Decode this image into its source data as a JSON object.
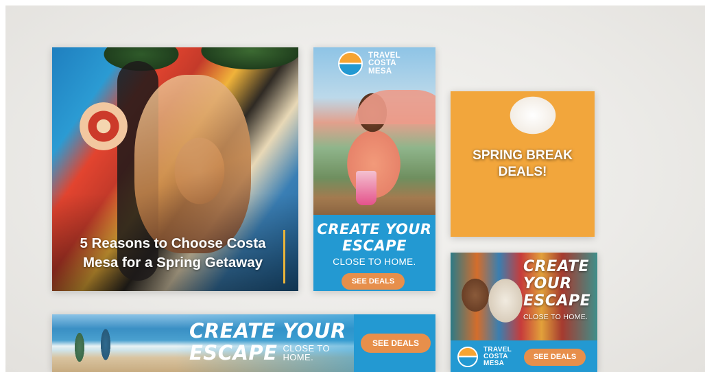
{
  "card_mural": {
    "caption_line1": "5 Reasons to Choose Costa",
    "caption_line2": "Mesa for a Spring Getaway",
    "accent_color": "#e8b33a"
  },
  "card_vertical": {
    "logo_line1": "TRAVEL",
    "logo_line2": "COSTA",
    "logo_line3": "MESA",
    "headline_line1": "CREATE YOUR",
    "headline_line2": "ESCAPE",
    "subline": "CLOSE TO HOME.",
    "cta": "SEE DEALS"
  },
  "card_spring": {
    "title_line1": "SPRING BREAK",
    "title_line2": "DEALS!"
  },
  "card_square": {
    "headline_line1": "CREATE",
    "headline_line2": "YOUR",
    "headline_line3": "ESCAPE",
    "subline": "CLOSE TO HOME.",
    "logo_line1": "TRAVEL",
    "logo_line2": "COSTA",
    "logo_line3": "MESA",
    "cta": "SEE DEALS"
  },
  "card_banner": {
    "headline_line1": "CREATE YOUR",
    "headline_line2": "ESCAPE",
    "subline_line1": "CLOSE TO",
    "subline_line2": "HOME.",
    "cta": "SEE DEALS"
  },
  "colors": {
    "brand_blue": "#2399d2",
    "cta_orange": "#e78f4b",
    "sun_orange": "#f6a432"
  },
  "icons": [
    "sun-logo-icon"
  ]
}
